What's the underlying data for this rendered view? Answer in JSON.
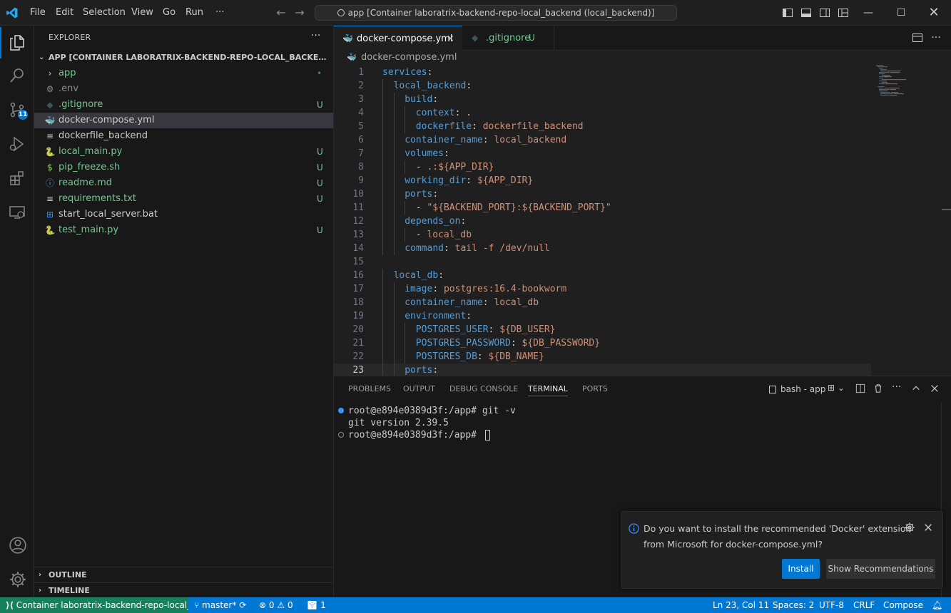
{
  "titlebar": {
    "menu": [
      "File",
      "Edit",
      "Selection",
      "View",
      "Go",
      "Run"
    ],
    "more": "···",
    "command_center": "app [Container laboratrix-backend-repo-local_backend (local_backend)]"
  },
  "activity": {
    "scm_badge": "11"
  },
  "sidebar": {
    "title": "EXPLORER",
    "more": "···",
    "root": "APP [CONTAINER LABORATRIX-BACKEND-REPO-LOCAL_BACKEND (LOCAL_...",
    "items": [
      {
        "name": "app",
        "status": "•",
        "kind": "folder"
      },
      {
        "name": ".env",
        "status": "",
        "kind": "env"
      },
      {
        "name": ".gitignore",
        "status": "U",
        "kind": "git"
      },
      {
        "name": "docker-compose.yml",
        "status": "",
        "kind": "docker"
      },
      {
        "name": "dockerfile_backend",
        "status": "",
        "kind": "lines"
      },
      {
        "name": "local_main.py",
        "status": "U",
        "kind": "python"
      },
      {
        "name": "pip_freeze.sh",
        "status": "U",
        "kind": "shell"
      },
      {
        "name": "readme.md",
        "status": "U",
        "kind": "info"
      },
      {
        "name": "requirements.txt",
        "status": "U",
        "kind": "lines"
      },
      {
        "name": "start_local_server.bat",
        "status": "",
        "kind": "windows"
      },
      {
        "name": "test_main.py",
        "status": "U",
        "kind": "python"
      }
    ],
    "outline": "OUTLINE",
    "timeline": "TIMELINE"
  },
  "tabs": [
    {
      "label": "docker-compose.yml",
      "close": "×"
    },
    {
      "label": ".gitignore",
      "status": "U"
    }
  ],
  "breadcrumb": "docker-compose.yml",
  "editor": {
    "lines": [
      {
        "n": "1",
        "indent": 0,
        "key": "services",
        "sep": ":",
        "val": ""
      },
      {
        "n": "2",
        "indent": 1,
        "key": "local_backend",
        "sep": ":",
        "val": ""
      },
      {
        "n": "3",
        "indent": 2,
        "key": "build",
        "sep": ":",
        "val": ""
      },
      {
        "n": "4",
        "indent": 3,
        "key": "context",
        "sep": ": .",
        "val": ""
      },
      {
        "n": "5",
        "indent": 3,
        "key": "dockerfile",
        "sep": ": ",
        "val": "dockerfile_backend"
      },
      {
        "n": "6",
        "indent": 2,
        "key": "container_name",
        "sep": ": ",
        "val": "local_backend"
      },
      {
        "n": "7",
        "indent": 2,
        "key": "volumes",
        "sep": ":",
        "val": ""
      },
      {
        "n": "8",
        "indent": 3,
        "key": "",
        "sep": "- ",
        "val": ".:${APP_DIR}"
      },
      {
        "n": "9",
        "indent": 2,
        "key": "working_dir",
        "sep": ": ",
        "val": "${APP_DIR}"
      },
      {
        "n": "10",
        "indent": 2,
        "key": "ports",
        "sep": ":",
        "val": ""
      },
      {
        "n": "11",
        "indent": 3,
        "key": "",
        "sep": "- ",
        "val": "\"${BACKEND_PORT}:${BACKEND_PORT}\""
      },
      {
        "n": "12",
        "indent": 2,
        "key": "depends_on",
        "sep": ":",
        "val": ""
      },
      {
        "n": "13",
        "indent": 3,
        "key": "",
        "sep": "- ",
        "val": "local_db"
      },
      {
        "n": "14",
        "indent": 2,
        "key": "command",
        "sep": ": ",
        "val": "tail -f /dev/null"
      },
      {
        "n": "15",
        "indent": 0,
        "key": "",
        "sep": "",
        "val": ""
      },
      {
        "n": "16",
        "indent": 1,
        "key": "local_db",
        "sep": ":",
        "val": ""
      },
      {
        "n": "17",
        "indent": 2,
        "key": "image",
        "sep": ": ",
        "val": "postgres:16.4-bookworm"
      },
      {
        "n": "18",
        "indent": 2,
        "key": "container_name",
        "sep": ": ",
        "val": "local_db"
      },
      {
        "n": "19",
        "indent": 2,
        "key": "environment",
        "sep": ":",
        "val": ""
      },
      {
        "n": "20",
        "indent": 3,
        "key": "POSTGRES_USER",
        "sep": ": ",
        "val": "${DB_USER}"
      },
      {
        "n": "21",
        "indent": 3,
        "key": "POSTGRES_PASSWORD",
        "sep": ": ",
        "val": "${DB_PASSWORD}"
      },
      {
        "n": "22",
        "indent": 3,
        "key": "POSTGRES_DB",
        "sep": ": ",
        "val": "${DB_NAME}"
      },
      {
        "n": "23",
        "indent": 2,
        "key": "ports",
        "sep": ":",
        "val": ""
      }
    ],
    "current_line": "23"
  },
  "panel": {
    "tabs": [
      "PROBLEMS",
      "OUTPUT",
      "DEBUG CONSOLE",
      "TERMINAL",
      "PORTS"
    ],
    "active_tab": "TERMINAL",
    "terminal_name": "bash - app",
    "lines": [
      {
        "text": "root@e894e0389d3f:/app# git -v",
        "dot": "filled"
      },
      {
        "text": "git version 2.39.5",
        "dot": ""
      },
      {
        "text": "root@e894e0389d3f:/app# ",
        "dot": "hollow"
      }
    ]
  },
  "notification": {
    "line1": "Do you want to install the recommended 'Docker' extension",
    "line2": "from Microsoft for docker-compose.yml?",
    "install": "Install",
    "show": "Show Recommendations"
  },
  "statusbar": {
    "remote": "Container laboratrix-backend-repo-local_...",
    "branch": "master*",
    "errors": "0",
    "warnings": "0",
    "ports": "1",
    "position": "Ln 23, Col 11",
    "spaces": "Spaces: 2",
    "encoding": "UTF-8",
    "eol": "CRLF",
    "language": "Compose"
  },
  "colors": {
    "accent": "#0078d4",
    "remote": "#16825d",
    "yaml_key": "#569cd6",
    "yaml_value": "#ce9178",
    "untracked": "#73c991"
  }
}
